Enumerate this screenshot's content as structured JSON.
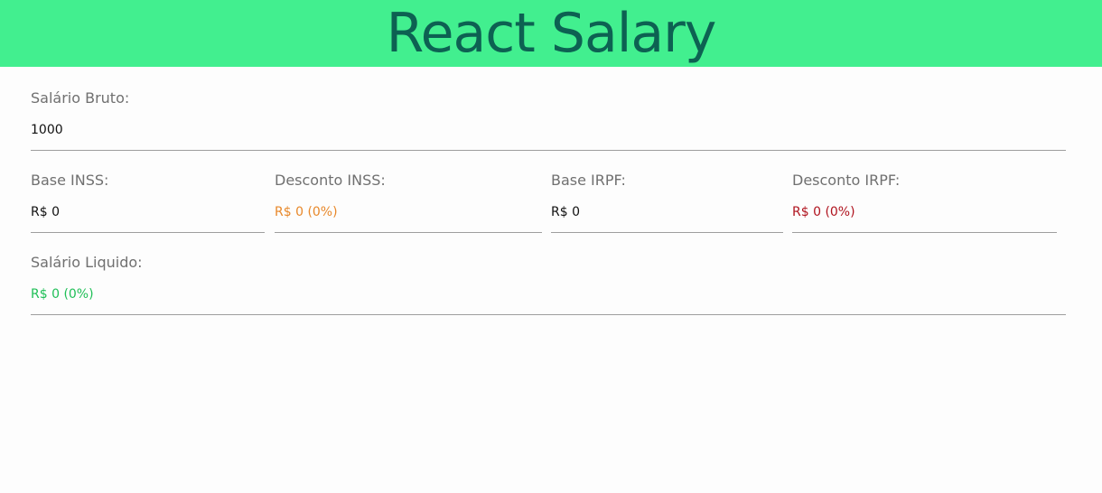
{
  "header": {
    "title": "React Salary"
  },
  "salario_bruto": {
    "label": "Salário Bruto:",
    "value": "1000"
  },
  "base_inss": {
    "label": "Base INSS:",
    "value": "R$ 0"
  },
  "desconto_inss": {
    "label": "Desconto INSS:",
    "value": "R$ 0 (0%)",
    "color": "#e8882a"
  },
  "base_irpf": {
    "label": "Base IRPF:",
    "value": "R$ 0"
  },
  "desconto_irpf": {
    "label": "Desconto IRPF:",
    "value": "R$ 0 (0%)",
    "color": "#b0141f"
  },
  "salario_liquido": {
    "label": "Salário Liquido:",
    "value": "R$ 0 (0%)",
    "color": "#1fbf57"
  }
}
